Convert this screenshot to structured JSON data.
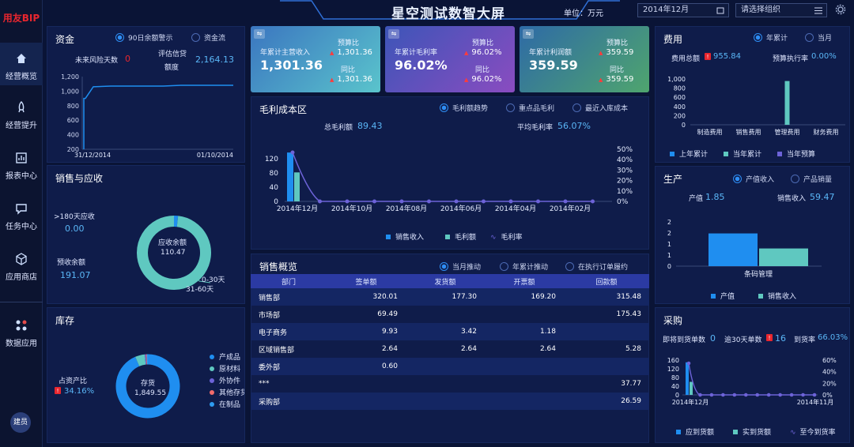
{
  "app": {
    "logo": "用友BIP",
    "title": "星空测试数智大屏",
    "unit": "单位：万元",
    "date": "2014年12月",
    "org_placeholder": "请选择组织"
  },
  "nav": [
    {
      "label": "经营概览",
      "icon": "home-icon"
    },
    {
      "label": "经营提升",
      "icon": "rocket-icon"
    },
    {
      "label": "报表中心",
      "icon": "report-icon"
    },
    {
      "label": "任务中心",
      "icon": "chat-icon"
    },
    {
      "label": "应用商店",
      "icon": "cube-icon"
    },
    {
      "label": "数据应用",
      "icon": "apps-icon"
    }
  ],
  "user": {
    "avatar": "建员"
  },
  "funds": {
    "title": "资金",
    "radio1": "90日余额警示",
    "radio2": "资金流",
    "risk_days_label": "未来风险天数",
    "risk_days": "0",
    "credit_label1": "评估信贷",
    "credit_label2": "额度",
    "credit": "2,164.13",
    "chart_data": {
      "type": "line",
      "x": [
        "31/12/2014",
        "",
        "",
        "",
        "",
        "",
        "",
        "",
        "",
        "01/10/2014"
      ],
      "values": [
        900,
        1060,
        1070,
        1070,
        1070,
        1070,
        1080,
        1080,
        1080,
        1080
      ],
      "yticks": [
        "1,200",
        "1,000",
        "800",
        "600",
        "400",
        "200"
      ],
      "ylim": [
        200,
        1200
      ]
    }
  },
  "sales": {
    "title": "销售与应收",
    "over180_label": ">180天应收",
    "over180": "0.00",
    "prepay_label": "预收余额",
    "prepay": "191.07",
    "center_label": "应收余额",
    "center_value": "110.47",
    "seg1": "0-30天",
    "seg2": "31-60天",
    "chart_data": {
      "type": "pie",
      "labels": [
        "0-30天",
        "31-60天"
      ],
      "values": [
        108.5,
        1.97
      ]
    }
  },
  "inventory": {
    "title": "库存",
    "ratio_label": "占资产比",
    "ratio": "34.16%",
    "center_label": "存货",
    "center_value": "1,849.55",
    "legend": [
      "产成品",
      "原材料",
      "外协件",
      "其他存货",
      "在制品"
    ],
    "chart_data": {
      "type": "pie",
      "labels": [
        "产成品",
        "原材料",
        "外协件",
        "其他存货",
        "在制品"
      ],
      "values": [
        1730,
        90,
        10,
        8,
        11
      ]
    }
  },
  "kpi": [
    {
      "label": "年累计主营收入",
      "value": "1,301.36",
      "l1": "预算比",
      "v1": "1,301.36",
      "l2": "同比",
      "v2": "1,301.36"
    },
    {
      "label": "年累计毛利率",
      "value": "96.02%",
      "l1": "预算比",
      "v1": "96.02%",
      "l2": "同比",
      "v2": "96.02%"
    },
    {
      "label": "年累计利润额",
      "value": "359.59",
      "l1": "预算比",
      "v1": "359.59",
      "l2": "同比",
      "v2": "359.59"
    }
  ],
  "gross": {
    "title": "毛利成本区",
    "radio1": "毛利额趋势",
    "radio2": "重点品毛利",
    "radio3": "最近入库成本",
    "total_label": "总毛利额",
    "total": "89.43",
    "avg_label": "平均毛利率",
    "avg": "56.07%",
    "chart_data": {
      "type": "bar",
      "categories": [
        "2014年12月",
        "2014年11月",
        "2014年10月",
        "2014年09月",
        "2014年08月",
        "2014年07月",
        "2014年06月",
        "2014年05月",
        "2014年04月",
        "2014年03月",
        "2014年02月",
        "2014年01月"
      ],
      "xticks": [
        "2014年12月",
        "2014年10月",
        "2014年08月",
        "2014年06月",
        "2014年04月",
        "2014年02月"
      ],
      "series": [
        {
          "name": "销售收入",
          "values": [
            150,
            0,
            0,
            0,
            0,
            0,
            0,
            0,
            0,
            0,
            0,
            0
          ]
        },
        {
          "name": "毛利额",
          "values": [
            89,
            0,
            0,
            0,
            0,
            0,
            0,
            0,
            0,
            0,
            0,
            0
          ]
        },
        {
          "name": "毛利率",
          "values": [
            56,
            0,
            0,
            0,
            0,
            0,
            0,
            0,
            0,
            0,
            0,
            0
          ]
        }
      ],
      "yticks": [
        "120",
        "80",
        "40",
        "0"
      ],
      "y2ticks": [
        "50%",
        "40%",
        "30%",
        "20%",
        "10%",
        "0%"
      ],
      "ylim": [
        0,
        160
      ]
    }
  },
  "sales_overview": {
    "title": "销售概览",
    "radio1": "当月推动",
    "radio2": "年累计推动",
    "radio3": "在执行订单履约",
    "columns": [
      "部门",
      "签单额",
      "发货额",
      "开票额",
      "回款额"
    ],
    "rows": [
      [
        "销售部",
        "320.01",
        "177.30",
        "169.20",
        "315.48"
      ],
      [
        "市场部",
        "69.49",
        "",
        "",
        "175.43"
      ],
      [
        "电子商务",
        "9.93",
        "3.42",
        "1.18",
        ""
      ],
      [
        "区域销售部",
        "2.64",
        "2.64",
        "2.64",
        "5.28"
      ],
      [
        "委外部",
        "0.60",
        "",
        "",
        ""
      ],
      [
        "***",
        "",
        "",
        "",
        "37.77"
      ],
      [
        "采购部",
        "",
        "",
        "",
        "26.59"
      ]
    ]
  },
  "expense": {
    "title": "费用",
    "radio1": "年累计",
    "radio2": "当月",
    "total_label": "费用总额",
    "total": "955.84",
    "rate_label": "预算执行率",
    "rate": "0.00%",
    "legend": [
      "上年累计",
      "当年累计",
      "当年预算"
    ],
    "chart_data": {
      "type": "bar",
      "categories": [
        "制造费用",
        "销售费用",
        "管理费用",
        "财务费用"
      ],
      "series": [
        {
          "name": "上年累计",
          "values": [
            0,
            0,
            0,
            0
          ]
        },
        {
          "name": "当年累计",
          "values": [
            0,
            0,
            955,
            0
          ]
        },
        {
          "name": "当年预算",
          "values": [
            0,
            0,
            0,
            0
          ]
        }
      ],
      "yticks": [
        "1,000",
        "800",
        "600",
        "400",
        "200",
        "0"
      ],
      "ylim": [
        0,
        1000
      ]
    }
  },
  "production": {
    "title": "生产",
    "radio1": "产值收入",
    "radio2": "产品销量",
    "output_label": "产值",
    "output": "1.85",
    "sales_label": "销售收入",
    "sales": "59.47",
    "legend": [
      "产值",
      "销售收入"
    ],
    "chart_data": {
      "type": "bar",
      "categories": [
        "条码管理"
      ],
      "series": [
        {
          "name": "产值",
          "values": [
            1.85
          ]
        },
        {
          "name": "销售收入",
          "values": [
            1.0
          ]
        }
      ],
      "yticks": [
        "2",
        "2",
        "1",
        "1",
        "0"
      ],
      "ylim": [
        0,
        2.5
      ]
    }
  },
  "purchase": {
    "title": "采购",
    "pending_label": "即将到货单数",
    "pending": "0",
    "overdue_label": "逾30天单数",
    "overdue": "16",
    "rate_label": "到货率",
    "rate": "66.03%",
    "legend": [
      "应到货额",
      "实到货额",
      "至今到货率"
    ],
    "chart_data": {
      "type": "bar",
      "x": [
        "2014年12月",
        "2014年11月"
      ],
      "series": [
        {
          "name": "应到货额",
          "values": [
            150
          ]
        },
        {
          "name": "实到货额",
          "values": [
            60
          ]
        },
        {
          "name": "至今到货率",
          "values": [
            50
          ]
        }
      ],
      "yticks": [
        "160",
        "120",
        "80",
        "40",
        "0"
      ],
      "y2ticks": [
        "60%",
        "40%",
        "20%",
        "0%"
      ]
    }
  }
}
